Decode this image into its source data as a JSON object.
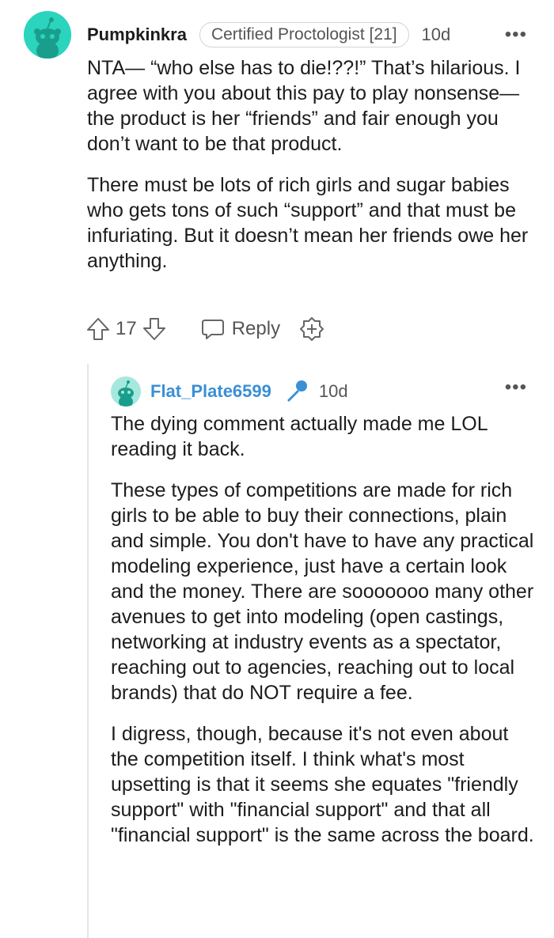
{
  "comment": {
    "username": "Pumpkinkra",
    "flair": "Certified Proctologist [21]",
    "time": "10d",
    "more": "•••",
    "paragraphs": [
      "NTA— “who else has to die!??!” That’s hilarious. I agree with you about this pay to play nonsense— the product is her “friends” and fair enough you don’t want to be that product.",
      "There must be lots of rich girls and sugar babies who gets tons of such “support” and that must be infuriating. But it doesn’t mean her friends owe her anything."
    ],
    "votes": "17",
    "reply_label": "Reply",
    "icons": {
      "avatar": "snoo-avatar-icon",
      "upvote": "upvote-arrow-icon",
      "downvote": "downvote-arrow-icon",
      "reply": "speech-bubble-icon",
      "award": "award-plus-icon"
    }
  },
  "reply": {
    "username": "Flat_Plate6599",
    "time": "10d",
    "more": "•••",
    "paragraphs": [
      "The dying comment actually made me LOL reading it back.",
      "These types of competitions are made for rich girls to be able to buy their connections, plain and simple. You don't have to have any practical modeling experience, just have a certain look and the money. There are sooooooo many other avenues to get into modeling (open castings, networking at industry events as a spectator, reaching out to agencies, reaching out to local brands) that do NOT require a fee.",
      "I digress, though, because it's not even about the competition itself. I think what's most upsetting is that it seems she equates \"friendly support\" with \"financial support\" and that all \"financial support\" is the same across the board."
    ],
    "icons": {
      "avatar": "snoo-avatar-icon",
      "badge": "microphone-icon"
    }
  },
  "colors": {
    "avatar_bg": "#2bd4bd",
    "reply_username": "#3a8fd6",
    "mic": "#3a8fd6"
  }
}
